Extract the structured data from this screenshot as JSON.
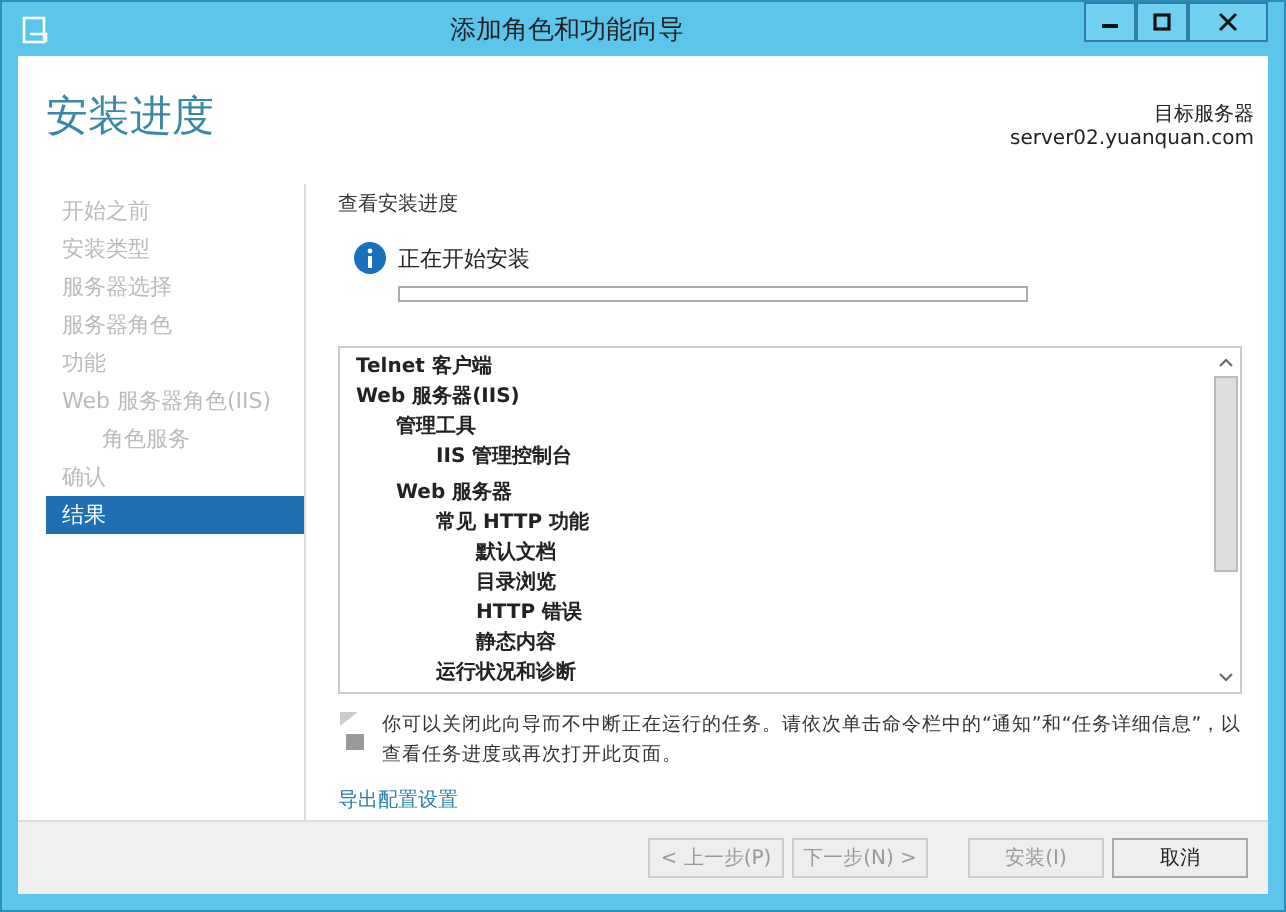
{
  "window": {
    "title": "添加角色和功能向导"
  },
  "header": {
    "title": "安装进度",
    "server_label": "目标服务器",
    "server_name": "server02.yuanquan.com"
  },
  "sidebar": {
    "items": [
      {
        "label": "开始之前",
        "selected": false
      },
      {
        "label": "安装类型",
        "selected": false
      },
      {
        "label": "服务器选择",
        "selected": false
      },
      {
        "label": "服务器角色",
        "selected": false
      },
      {
        "label": "功能",
        "selected": false
      },
      {
        "label": "Web 服务器角色(IIS)",
        "selected": false,
        "children": [
          {
            "label": "角色服务",
            "selected": false
          }
        ]
      },
      {
        "label": "确认",
        "selected": false
      },
      {
        "label": "结果",
        "selected": true
      }
    ]
  },
  "content": {
    "heading": "查看安装进度",
    "status": "正在开始安装",
    "progress": {
      "level": 0
    },
    "tree": [
      {
        "label": "Telnet 客户端"
      },
      {
        "label": "Web 服务器(IIS)",
        "children": [
          {
            "label": "管理工具",
            "children": [
              {
                "label": "IIS 管理控制台"
              }
            ]
          },
          {
            "label": "Web 服务器",
            "children": [
              {
                "label": "常见 HTTP 功能",
                "children": [
                  {
                    "label": "默认文档"
                  },
                  {
                    "label": "目录浏览"
                  },
                  {
                    "label": "HTTP 错误"
                  },
                  {
                    "label": "静态内容"
                  }
                ]
              },
              {
                "label": "运行状况和诊断"
              }
            ]
          }
        ]
      }
    ],
    "note": "你可以关闭此向导而不中断正在运行的任务。请依次单击命令栏中的“通知”和“任务详细信息”，以查看任务进度或再次打开此页面。",
    "link": "导出配置设置"
  },
  "buttons": [
    {
      "label": "< 上一步(P)",
      "disabled": true
    },
    {
      "label": "下一步(N) >",
      "disabled": true
    },
    {
      "label": "安装(I)",
      "disabled": true
    },
    {
      "label": "取消",
      "disabled": false
    }
  ]
}
